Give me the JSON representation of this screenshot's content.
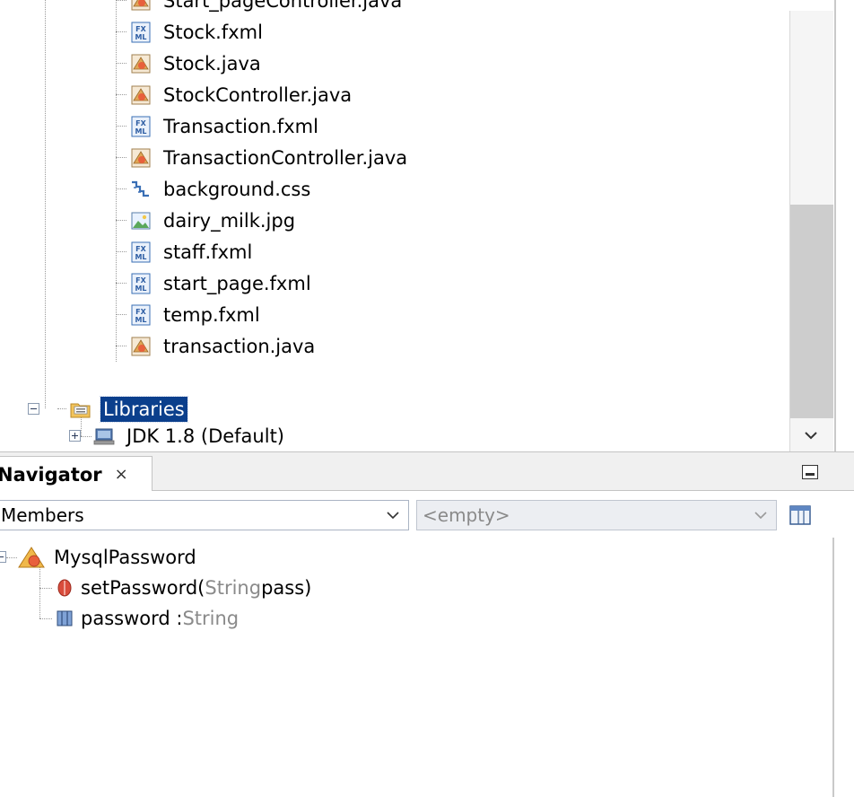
{
  "project_tree": {
    "files": [
      {
        "name": "Start_pageController.java",
        "icon": "java-class-icon"
      },
      {
        "name": "Stock.fxml",
        "icon": "fxml-file-icon"
      },
      {
        "name": "Stock.java",
        "icon": "java-class-icon"
      },
      {
        "name": "StockController.java",
        "icon": "java-class-icon"
      },
      {
        "name": "Transaction.fxml",
        "icon": "fxml-file-icon"
      },
      {
        "name": "TransactionController.java",
        "icon": "java-class-icon"
      },
      {
        "name": "background.css",
        "icon": "css-file-icon"
      },
      {
        "name": "dairy_milk.jpg",
        "icon": "image-file-icon"
      },
      {
        "name": "staff.fxml",
        "icon": "fxml-file-icon"
      },
      {
        "name": "start_page.fxml",
        "icon": "fxml-file-icon"
      },
      {
        "name": "temp.fxml",
        "icon": "fxml-file-icon"
      },
      {
        "name": "transaction.java",
        "icon": "java-class-icon"
      }
    ],
    "libraries_label": "Libraries",
    "jdk_label": "JDK 1.8 (Default)"
  },
  "navigator": {
    "title": "Navigator",
    "close_symbol": "×",
    "members_label": "Members",
    "empty_label": "<empty>",
    "class_name": "MysqlPassword",
    "method": {
      "name": "setPassword(",
      "param_type": "String",
      "rest": " pass)"
    },
    "field": {
      "name": "password : ",
      "type": "String"
    }
  },
  "colors": {
    "selection": "#0b3f8c",
    "java_icon": "#d9a86b",
    "fxml_icon": "#3a6fb5",
    "method_icon": "#d94c3c",
    "field_icon": "#4a6fa8"
  }
}
